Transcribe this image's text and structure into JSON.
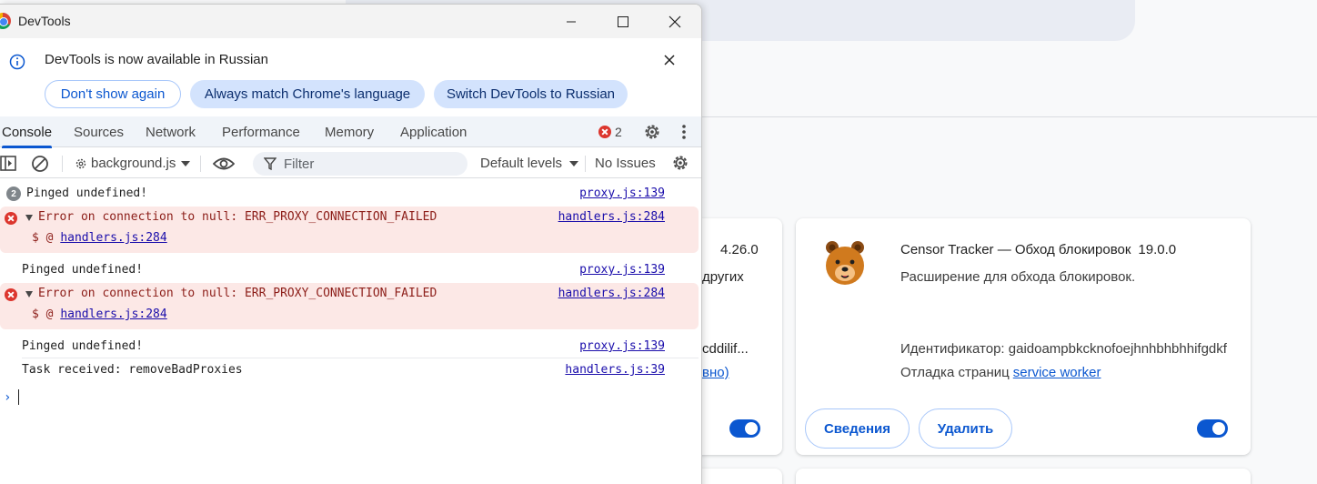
{
  "window": {
    "title": "DevTools"
  },
  "infobar": {
    "message": "DevTools is now available in Russian",
    "dont_show": "Don't show again",
    "always_match": "Always match Chrome's language",
    "switch": "Switch DevTools to Russian"
  },
  "tabs": [
    {
      "label": "Console",
      "active": true
    },
    {
      "label": "Sources"
    },
    {
      "label": "Network"
    },
    {
      "label": "Performance"
    },
    {
      "label": "Memory"
    },
    {
      "label": "Application"
    }
  ],
  "error_count": "2",
  "toolbar": {
    "context": "background.js",
    "filter_placeholder": "Filter",
    "levels": "Default levels",
    "issues": "No Issues"
  },
  "console": {
    "messages": [
      {
        "type": "log",
        "count": "2",
        "text": "Pinged undefined!",
        "source": "proxy.js:139"
      },
      {
        "type": "error",
        "text": "Error on connection to null: ERR_PROXY_CONNECTION_FAILED",
        "source": "handlers.js:284",
        "stack_prefix": "$ @ ",
        "stack_link": "handlers.js:284"
      },
      {
        "type": "log",
        "text": "Pinged undefined!",
        "source": "proxy.js:139"
      },
      {
        "type": "error",
        "text": "Error on connection to null: ERR_PROXY_CONNECTION_FAILED",
        "source": "handlers.js:284",
        "stack_prefix": "$ @ ",
        "stack_link": "handlers.js:284"
      },
      {
        "type": "log",
        "text": "Pinged undefined!",
        "source": "proxy.js:139"
      },
      {
        "type": "log",
        "text": "Task received: removeBadProxies",
        "source": "handlers.js:39"
      }
    ],
    "prompt": "›"
  },
  "background": {
    "left_card": {
      "version": "4.26.0",
      "line1": "других",
      "line2": "cddilif...",
      "line3": "вно)"
    },
    "extension": {
      "name": "Censor Tracker — Обход блокировок",
      "version": "19.0.0",
      "description": "Расширение для обхода блокировок.",
      "id_label": "Идентификатор: gaidoampbkcknofoejhnhbhbhhifgdkf",
      "inspect_label": "Отладка страниц",
      "inspect_link": "service worker",
      "details": "Сведения",
      "remove": "Удалить"
    }
  },
  "colors": {
    "accent": "#0b57d0",
    "error_bg": "#fce8e6",
    "error_text": "#8c1d18",
    "chip_bg": "#d3e3fd"
  }
}
